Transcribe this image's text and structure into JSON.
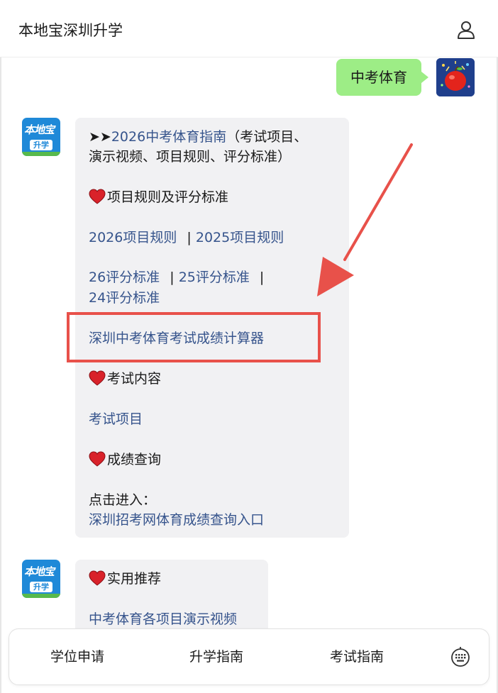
{
  "header": {
    "title": "本地宝深圳升学"
  },
  "user_message": {
    "text": "中考体育"
  },
  "bot_avatar": {
    "brand": "本地宝",
    "sub": "升学"
  },
  "message1": {
    "intro_arrows": "➤➤",
    "intro_link": "2026中考体育指南",
    "intro_rest_1": "（考试项目、",
    "intro_rest_2": "演示视频、项目规则、评分标准）",
    "section_rules": "项目规则及评分标准",
    "rules_2026": "2026项目规则",
    "rules_2025": "2025项目规则",
    "score_26": "26评分标准",
    "score_25": "25评分标准",
    "score_24": "24评分标准",
    "separator": "|",
    "calculator": "深圳中考体育考试成绩计算器",
    "section_content": "考试内容",
    "exam_items": "考试项目",
    "section_score": "成绩查询",
    "click_enter": "点击进入：",
    "score_query_link": "深圳招考网体育成绩查询入口"
  },
  "message2": {
    "section_recommend": "实用推荐",
    "demo_videos": "中考体育各项目演示视频"
  },
  "bottom_tabs": [
    "学位申请",
    "升学指南",
    "考试指南"
  ],
  "colors": {
    "link": "#36548c",
    "user_bubble": "#9ded86",
    "highlight": "#e8514a",
    "bot_bubble": "#f1f1f3"
  }
}
